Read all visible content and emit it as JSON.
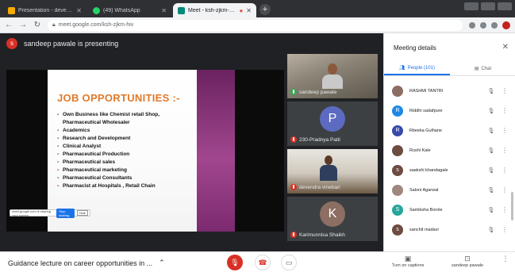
{
  "browser": {
    "tabs": [
      {
        "label": "Presentation - devendra vinebari",
        "fav_color": "#f9ab00",
        "active": false
      },
      {
        "label": "(49) WhatsApp",
        "fav_color": "#25d366",
        "active": false
      },
      {
        "label": "Meet - ksh-zjkm-hiv",
        "fav_color": "#00897b",
        "active": true
      }
    ],
    "address": "meet.google.com/ksh-zjkm-hiv"
  },
  "meet": {
    "presenting_text": "sandeep pawale is presenting",
    "presenter_initial": "s",
    "slide": {
      "title": "JOB OPPORTUNITIES :-",
      "bullets": [
        "Own Business like Chemist retail Shop, Pharmaceutical Wholesaler",
        "Academics",
        "Research and Development",
        "Clinical Analyst",
        "Pharmaceutical Production",
        "Pharmaceutical sales",
        "Pharmaceutical marketing",
        "Pharmaceutical Consultants",
        "Pharmacist at Hospitals , Retail Chain"
      ],
      "share_bar": {
        "text": "meet.google.com is sharing your screen.",
        "stop_label": "Stop sharing",
        "hide_label": "Hide"
      }
    },
    "tiles": [
      {
        "name": "sandeep pawale",
        "kind": "video"
      },
      {
        "name": "230-Pradnya Patil",
        "kind": "letter",
        "letter": "P",
        "color": "#5c6bc0"
      },
      {
        "name": "devendra vinebari",
        "kind": "video"
      },
      {
        "name": "Karimunnisa Shaikh",
        "kind": "letter",
        "letter": "K",
        "color": "#8d6e63"
      }
    ],
    "meeting_title": "Guidance lecture on career opportunities in ...",
    "captions_label": "Turn on captions",
    "presenting_label": "sandeep pawale"
  },
  "panel": {
    "title": "Meeting details",
    "people_tab": "People (101)",
    "chat_tab": "Chat",
    "participants": [
      {
        "name": "RASHMI TANTRI",
        "initial": "",
        "color": "#8d6e63"
      },
      {
        "name": "Riddhi sadafpure",
        "initial": "R",
        "color": "#1e88e5"
      },
      {
        "name": "Riteeka Gulhane",
        "initial": "R",
        "color": "#3949ab"
      },
      {
        "name": "Rushi Kale",
        "initial": "",
        "color": "#6d4c41"
      },
      {
        "name": "saakshi khandagale",
        "initial": "s",
        "color": "#6d4c41"
      },
      {
        "name": "Saloni Agarwal",
        "initial": "",
        "color": "#a1887f"
      },
      {
        "name": "Samiksha Borole",
        "initial": "S",
        "color": "#26a69a"
      },
      {
        "name": "sanchit madavi",
        "initial": "s",
        "color": "#6d4c41"
      }
    ]
  }
}
